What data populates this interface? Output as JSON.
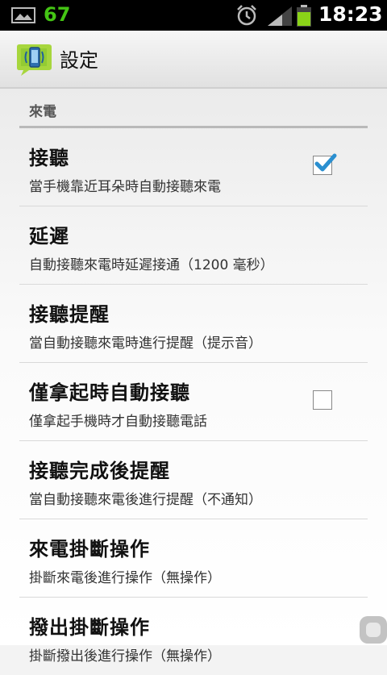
{
  "status_bar": {
    "notification_count": "67",
    "time": "18:23",
    "icons": [
      "image-icon",
      "alarm-icon",
      "signal-icon",
      "battery-icon"
    ]
  },
  "action_bar": {
    "title": "設定",
    "icon": "app-phone-icon"
  },
  "settings": {
    "category": "來電",
    "items": [
      {
        "title": "接聽",
        "summary": "當手機靠近耳朵時自動接聽來電",
        "checked": true
      },
      {
        "title": "延遲",
        "summary": "自動接聽來電時延遲接通（1200 毫秒）"
      },
      {
        "title": "接聽提醒",
        "summary": "當自動接聽來電時進行提醒（提示音）"
      },
      {
        "title": "僅拿起時自動接聽",
        "summary": "僅拿起手機時才自動接聽電話",
        "checked": false
      },
      {
        "title": "接聽完成後提醒",
        "summary": "當自動接聽來電後進行提醒（不通知）"
      },
      {
        "title": "來電掛斷操作",
        "summary": "掛斷來電後進行操作（無操作）"
      },
      {
        "title": "撥出掛斷操作",
        "summary": "掛斷撥出後進行操作（無操作）"
      }
    ]
  },
  "colors": {
    "status_bar_bg": "#000000",
    "count_green": "#44c414",
    "check_blue": "#2a8fd0",
    "battery_green": "#8ad318"
  }
}
